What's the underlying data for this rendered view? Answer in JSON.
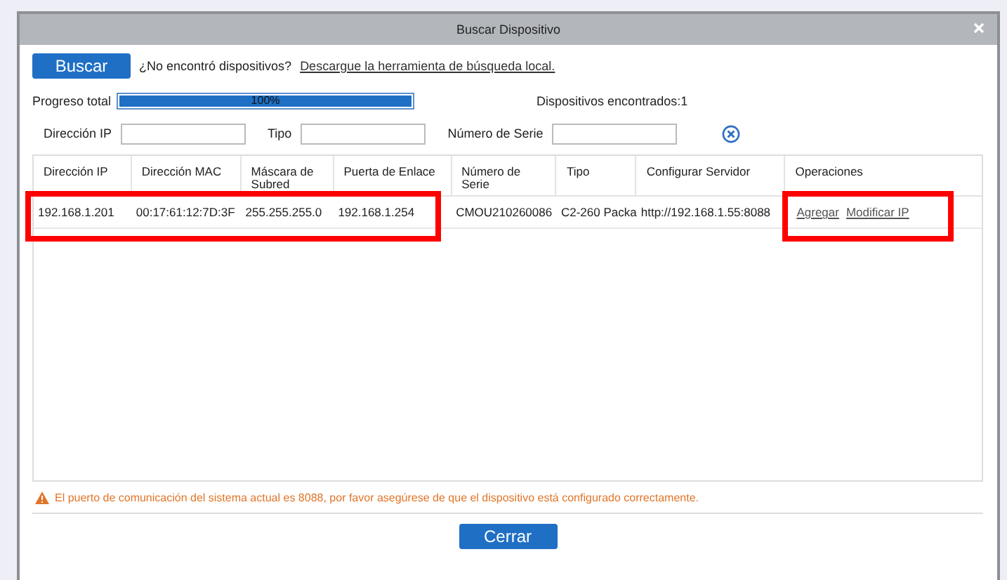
{
  "window": {
    "title": "Buscar Dispositivo"
  },
  "search_button": "Buscar",
  "hint": {
    "text": "¿No encontró dispositivos?",
    "link": "Descargue la herramienta de búsqueda local."
  },
  "progress": {
    "label": "Progreso total",
    "level": 1,
    "reading": "100%"
  },
  "found": "Dispositivos encontrados:1",
  "filters": [
    {
      "label": "Dirección IP"
    },
    {
      "label": "Tipo"
    },
    {
      "label": "Número de Serie"
    }
  ],
  "table": {
    "columns": [
      {
        "label": "Dirección IP",
        "highlighted": true
      },
      {
        "label": "Dirección MAC",
        "highlighted": true
      },
      {
        "label": "Máscara de Subred",
        "highlighted": true
      },
      {
        "label": "Puerta de Enlace",
        "highlighted": true
      },
      {
        "label": "Número de Serie",
        "highlighted": false
      },
      {
        "label": "Tipo",
        "highlighted": false
      },
      {
        "label": "Configurar Servidor",
        "highlighted": false
      },
      {
        "label": "Operaciones",
        "highlighted": true
      }
    ],
    "rows": [
      {
        "cells": [
          "192.168.1.201",
          "00:17:61:12:7D:3F",
          "255.255.255.0",
          "192.168.1.254",
          "CMOU210260086",
          "C2-260 Packa",
          "http://192.168.1.55:8088"
        ],
        "actions": [
          "Agregar",
          "Modificar IP"
        ]
      }
    ]
  },
  "warning": "El puerto de comunicación del sistema actual es 8088, por favor asegúrese de que el dispositivo está configurado correctamente.",
  "close_button": "Cerrar"
}
